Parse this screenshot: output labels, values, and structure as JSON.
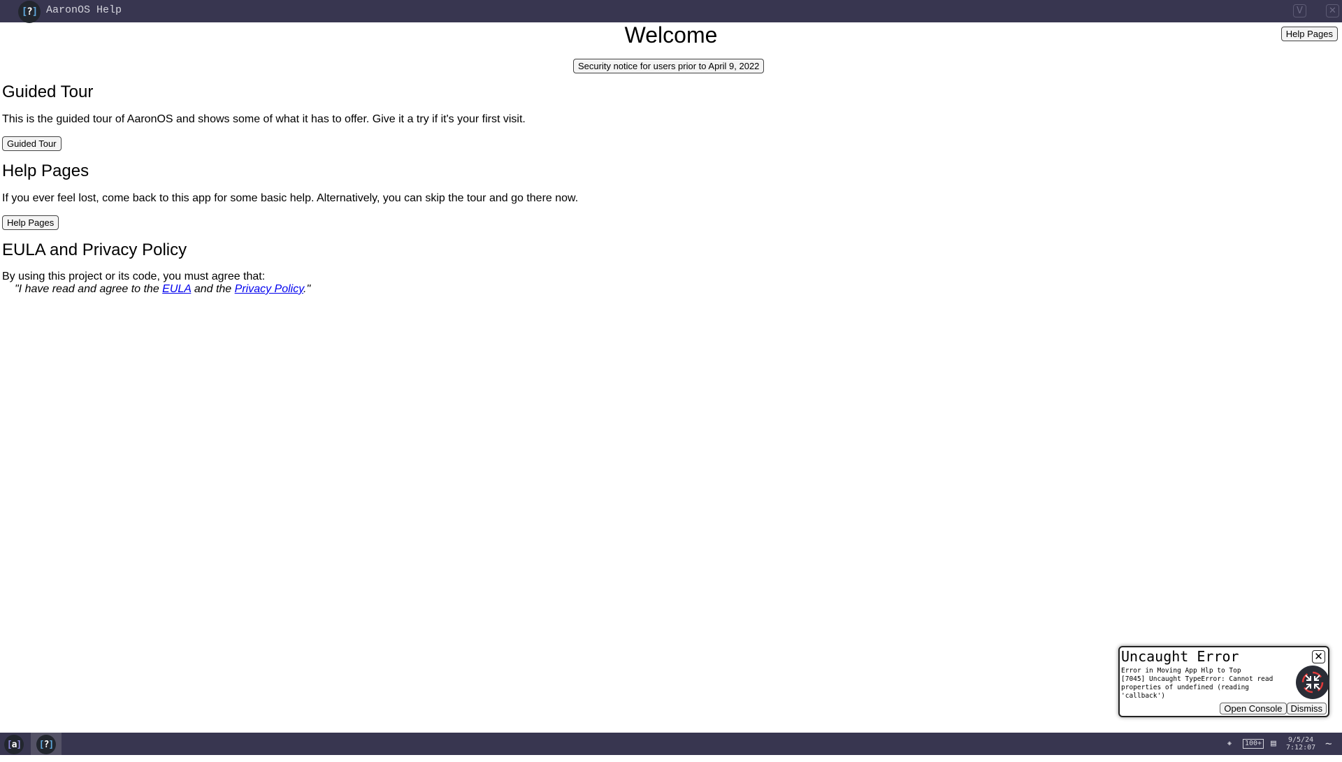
{
  "window": {
    "title": "AaronOS Help",
    "app_icon_glyph": "?",
    "minimize_icon": "chevron-down-icon",
    "minimize_glyph": "V",
    "close_icon": "close-icon",
    "close_glyph": "✕"
  },
  "page": {
    "title": "Welcome",
    "top_help_button": "Help Pages",
    "security_notice_button": "Security notice for users prior to April 9, 2022",
    "sections": [
      {
        "heading": "Guided Tour",
        "text": "This is the guided tour of AaronOS and shows some of what it has to offer. Give it a try if it's your first visit.",
        "button": "Guided Tour"
      },
      {
        "heading": "Help Pages",
        "text": "If you ever feel lost, come back to this app for some basic help. Alternatively, you can skip the tour and go there now.",
        "button": "Help Pages"
      },
      {
        "heading": "EULA and Privacy Policy",
        "text": "By using this project or its code, you must agree that:",
        "quote_prefix": "\"I have read and agree to the ",
        "eula_link": "EULA",
        "quote_middle": " and the ",
        "privacy_link": "Privacy Policy",
        "quote_suffix": ".\""
      }
    ]
  },
  "error_toast": {
    "title": "Uncaught Error",
    "message": "Error in Moving App Hlp to Top\n[7045] Uncaught TypeError: Cannot read properties of undefined (reading 'callback')",
    "close_glyph": "✕",
    "icon": "minimize-arrows-icon",
    "open_console_button": "Open Console",
    "dismiss_button": "Dismiss"
  },
  "taskbar": {
    "items": [
      {
        "name": "dashboard",
        "glyph": "a",
        "active": false
      },
      {
        "name": "help",
        "glyph": "?",
        "active": true
      }
    ],
    "tray": {
      "wifi_glyph": "◈",
      "battery": "100+",
      "notifications_glyph": "▤",
      "date": "9/5/24",
      "time": "7:12:07",
      "flow_glyph": "~"
    }
  }
}
